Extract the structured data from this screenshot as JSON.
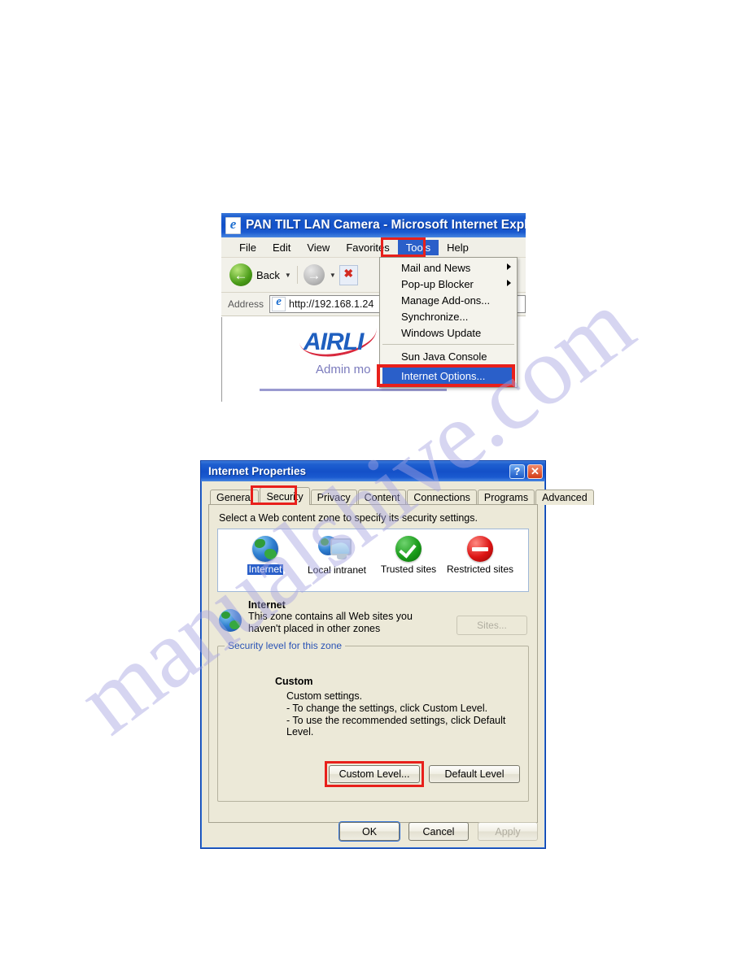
{
  "watermark": {
    "text": "manualshive.com"
  },
  "browser": {
    "title": "PAN TILT LAN Camera - Microsoft Internet Explo",
    "icon": "ie-document-icon",
    "menubar": [
      {
        "label": "File",
        "selected": false
      },
      {
        "label": "Edit",
        "selected": false
      },
      {
        "label": "View",
        "selected": false
      },
      {
        "label": "Favorites",
        "selected": false
      },
      {
        "label": "Tools",
        "selected": true
      },
      {
        "label": "Help",
        "selected": false
      }
    ],
    "toolbar": {
      "back_label": "Back",
      "back_icon": "back-arrow-icon",
      "forward_icon": "forward-arrow-icon",
      "dropdown_icon": "chevron-down-icon",
      "stop_icon": "stop-page-icon"
    },
    "address": {
      "label": "Address",
      "icon": "ie-page-icon",
      "value": "http://192.168.1.24"
    },
    "page": {
      "logo_text": "AIRLI",
      "subtitle": "Admin mo"
    }
  },
  "tools_menu": {
    "items": [
      {
        "label": "Mail and News",
        "submenu": true,
        "highlighted": false
      },
      {
        "label": "Pop-up Blocker",
        "submenu": true,
        "highlighted": false
      },
      {
        "label": "Manage Add-ons...",
        "submenu": false,
        "highlighted": false
      },
      {
        "label": "Synchronize...",
        "submenu": false,
        "highlighted": false
      },
      {
        "label": "Windows Update",
        "submenu": false,
        "highlighted": false
      },
      {
        "label": "Sun Java Console",
        "submenu": false,
        "highlighted": false
      },
      {
        "label": "Internet Options...",
        "submenu": false,
        "highlighted": true
      }
    ]
  },
  "dialog": {
    "title": "Internet Properties",
    "help_icon": "?",
    "close_icon": "✕",
    "tabs": [
      {
        "label": "General",
        "active": false
      },
      {
        "label": "Security",
        "active": true
      },
      {
        "label": "Privacy",
        "active": false
      },
      {
        "label": "Content",
        "active": false
      },
      {
        "label": "Connections",
        "active": false
      },
      {
        "label": "Programs",
        "active": false
      },
      {
        "label": "Advanced",
        "active": false
      }
    ],
    "security": {
      "intro": "Select a Web content zone to specify its security settings.",
      "zones": [
        {
          "label": "Internet",
          "icon": "globe-icon",
          "selected": true
        },
        {
          "label": "Local intranet",
          "icon": "intranet-computer-icon",
          "selected": false
        },
        {
          "label": "Trusted sites",
          "icon": "green-check-icon",
          "selected": false
        },
        {
          "label": "Restricted sites",
          "icon": "red-deny-icon",
          "selected": false
        }
      ],
      "zone_detail": {
        "icon": "globe-icon",
        "title": "Internet",
        "line1": "This zone contains all Web sites you",
        "line2": "haven't placed in other zones",
        "sites_button": "Sites...",
        "sites_button_enabled": false
      },
      "level_group": {
        "legend": "Security level for this zone",
        "heading": "Custom",
        "line1": "Custom settings.",
        "line2": "- To change the settings, click Custom Level.",
        "line3": "- To use the recommended settings, click Default Level.",
        "custom_level_button": "Custom Level...",
        "default_level_button": "Default Level"
      }
    },
    "footer": {
      "ok": "OK",
      "cancel": "Cancel",
      "apply": "Apply",
      "apply_enabled": false
    }
  },
  "highlights": {
    "color": "#e8201b"
  }
}
